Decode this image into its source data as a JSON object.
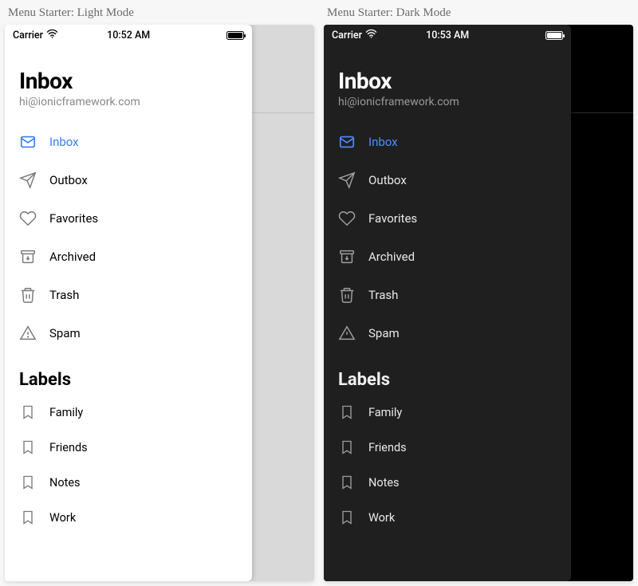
{
  "panels": {
    "light": {
      "title": "Menu Starter: Light Mode",
      "status": {
        "carrier": "Carrier",
        "time": "10:52 AM"
      }
    },
    "dark": {
      "title": "Menu Starter: Dark Mode",
      "status": {
        "carrier": "Carrier",
        "time": "10:53 AM"
      }
    }
  },
  "header": {
    "title": "Inbox",
    "subtitle": "hi@ionicframework.com"
  },
  "menu": {
    "items": [
      {
        "label": "Inbox",
        "icon": "mail-icon",
        "active": true
      },
      {
        "label": "Outbox",
        "icon": "send-icon",
        "active": false
      },
      {
        "label": "Favorites",
        "icon": "heart-icon",
        "active": false
      },
      {
        "label": "Archived",
        "icon": "archive-icon",
        "active": false
      },
      {
        "label": "Trash",
        "icon": "trash-icon",
        "active": false
      },
      {
        "label": "Spam",
        "icon": "warning-icon",
        "active": false
      }
    ]
  },
  "labels": {
    "title": "Labels",
    "items": [
      {
        "label": "Family",
        "icon": "bookmark-icon"
      },
      {
        "label": "Friends",
        "icon": "bookmark-icon"
      },
      {
        "label": "Notes",
        "icon": "bookmark-icon"
      },
      {
        "label": "Work",
        "icon": "bookmark-icon"
      }
    ]
  },
  "colors": {
    "accent_light": "#387ef5",
    "accent_dark": "#4c8dff"
  }
}
